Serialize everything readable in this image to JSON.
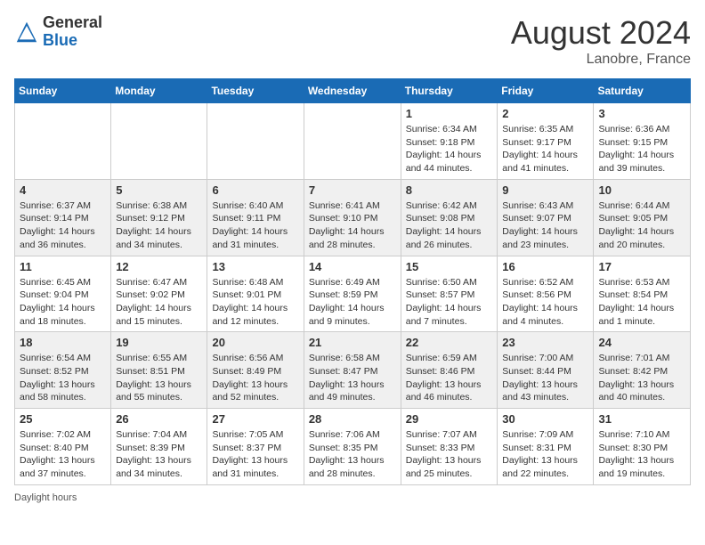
{
  "header": {
    "logo_general": "General",
    "logo_blue": "Blue",
    "month_year": "August 2024",
    "location": "Lanobre, France"
  },
  "calendar": {
    "days_of_week": [
      "Sunday",
      "Monday",
      "Tuesday",
      "Wednesday",
      "Thursday",
      "Friday",
      "Saturday"
    ],
    "weeks": [
      [
        {
          "day": "",
          "info": ""
        },
        {
          "day": "",
          "info": ""
        },
        {
          "day": "",
          "info": ""
        },
        {
          "day": "",
          "info": ""
        },
        {
          "day": "1",
          "info": "Sunrise: 6:34 AM\nSunset: 9:18 PM\nDaylight: 14 hours and 44 minutes."
        },
        {
          "day": "2",
          "info": "Sunrise: 6:35 AM\nSunset: 9:17 PM\nDaylight: 14 hours and 41 minutes."
        },
        {
          "day": "3",
          "info": "Sunrise: 6:36 AM\nSunset: 9:15 PM\nDaylight: 14 hours and 39 minutes."
        }
      ],
      [
        {
          "day": "4",
          "info": "Sunrise: 6:37 AM\nSunset: 9:14 PM\nDaylight: 14 hours and 36 minutes."
        },
        {
          "day": "5",
          "info": "Sunrise: 6:38 AM\nSunset: 9:12 PM\nDaylight: 14 hours and 34 minutes."
        },
        {
          "day": "6",
          "info": "Sunrise: 6:40 AM\nSunset: 9:11 PM\nDaylight: 14 hours and 31 minutes."
        },
        {
          "day": "7",
          "info": "Sunrise: 6:41 AM\nSunset: 9:10 PM\nDaylight: 14 hours and 28 minutes."
        },
        {
          "day": "8",
          "info": "Sunrise: 6:42 AM\nSunset: 9:08 PM\nDaylight: 14 hours and 26 minutes."
        },
        {
          "day": "9",
          "info": "Sunrise: 6:43 AM\nSunset: 9:07 PM\nDaylight: 14 hours and 23 minutes."
        },
        {
          "day": "10",
          "info": "Sunrise: 6:44 AM\nSunset: 9:05 PM\nDaylight: 14 hours and 20 minutes."
        }
      ],
      [
        {
          "day": "11",
          "info": "Sunrise: 6:45 AM\nSunset: 9:04 PM\nDaylight: 14 hours and 18 minutes."
        },
        {
          "day": "12",
          "info": "Sunrise: 6:47 AM\nSunset: 9:02 PM\nDaylight: 14 hours and 15 minutes."
        },
        {
          "day": "13",
          "info": "Sunrise: 6:48 AM\nSunset: 9:01 PM\nDaylight: 14 hours and 12 minutes."
        },
        {
          "day": "14",
          "info": "Sunrise: 6:49 AM\nSunset: 8:59 PM\nDaylight: 14 hours and 9 minutes."
        },
        {
          "day": "15",
          "info": "Sunrise: 6:50 AM\nSunset: 8:57 PM\nDaylight: 14 hours and 7 minutes."
        },
        {
          "day": "16",
          "info": "Sunrise: 6:52 AM\nSunset: 8:56 PM\nDaylight: 14 hours and 4 minutes."
        },
        {
          "day": "17",
          "info": "Sunrise: 6:53 AM\nSunset: 8:54 PM\nDaylight: 14 hours and 1 minute."
        }
      ],
      [
        {
          "day": "18",
          "info": "Sunrise: 6:54 AM\nSunset: 8:52 PM\nDaylight: 13 hours and 58 minutes."
        },
        {
          "day": "19",
          "info": "Sunrise: 6:55 AM\nSunset: 8:51 PM\nDaylight: 13 hours and 55 minutes."
        },
        {
          "day": "20",
          "info": "Sunrise: 6:56 AM\nSunset: 8:49 PM\nDaylight: 13 hours and 52 minutes."
        },
        {
          "day": "21",
          "info": "Sunrise: 6:58 AM\nSunset: 8:47 PM\nDaylight: 13 hours and 49 minutes."
        },
        {
          "day": "22",
          "info": "Sunrise: 6:59 AM\nSunset: 8:46 PM\nDaylight: 13 hours and 46 minutes."
        },
        {
          "day": "23",
          "info": "Sunrise: 7:00 AM\nSunset: 8:44 PM\nDaylight: 13 hours and 43 minutes."
        },
        {
          "day": "24",
          "info": "Sunrise: 7:01 AM\nSunset: 8:42 PM\nDaylight: 13 hours and 40 minutes."
        }
      ],
      [
        {
          "day": "25",
          "info": "Sunrise: 7:02 AM\nSunset: 8:40 PM\nDaylight: 13 hours and 37 minutes."
        },
        {
          "day": "26",
          "info": "Sunrise: 7:04 AM\nSunset: 8:39 PM\nDaylight: 13 hours and 34 minutes."
        },
        {
          "day": "27",
          "info": "Sunrise: 7:05 AM\nSunset: 8:37 PM\nDaylight: 13 hours and 31 minutes."
        },
        {
          "day": "28",
          "info": "Sunrise: 7:06 AM\nSunset: 8:35 PM\nDaylight: 13 hours and 28 minutes."
        },
        {
          "day": "29",
          "info": "Sunrise: 7:07 AM\nSunset: 8:33 PM\nDaylight: 13 hours and 25 minutes."
        },
        {
          "day": "30",
          "info": "Sunrise: 7:09 AM\nSunset: 8:31 PM\nDaylight: 13 hours and 22 minutes."
        },
        {
          "day": "31",
          "info": "Sunrise: 7:10 AM\nSunset: 8:30 PM\nDaylight: 13 hours and 19 minutes."
        }
      ]
    ]
  },
  "footer": {
    "note": "Daylight hours"
  }
}
